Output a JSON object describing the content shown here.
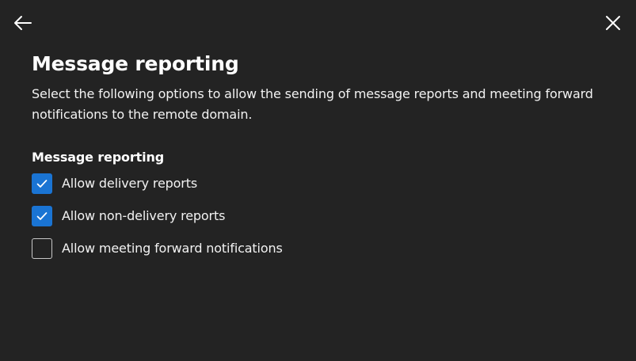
{
  "header": {
    "back_icon": "arrow-left-icon",
    "close_icon": "close-icon"
  },
  "main": {
    "title": "Message reporting",
    "description": "Select the following options to allow the sending of message reports and meeting forward notifications to the remote domain.",
    "section_label": "Message reporting",
    "options": [
      {
        "label": "Allow delivery reports",
        "checked": true
      },
      {
        "label": "Allow non-delivery reports",
        "checked": true
      },
      {
        "label": "Allow meeting forward notifications",
        "checked": false
      }
    ]
  },
  "colors": {
    "background": "#232323",
    "accent": "#1a74d3",
    "text": "#ffffff"
  }
}
